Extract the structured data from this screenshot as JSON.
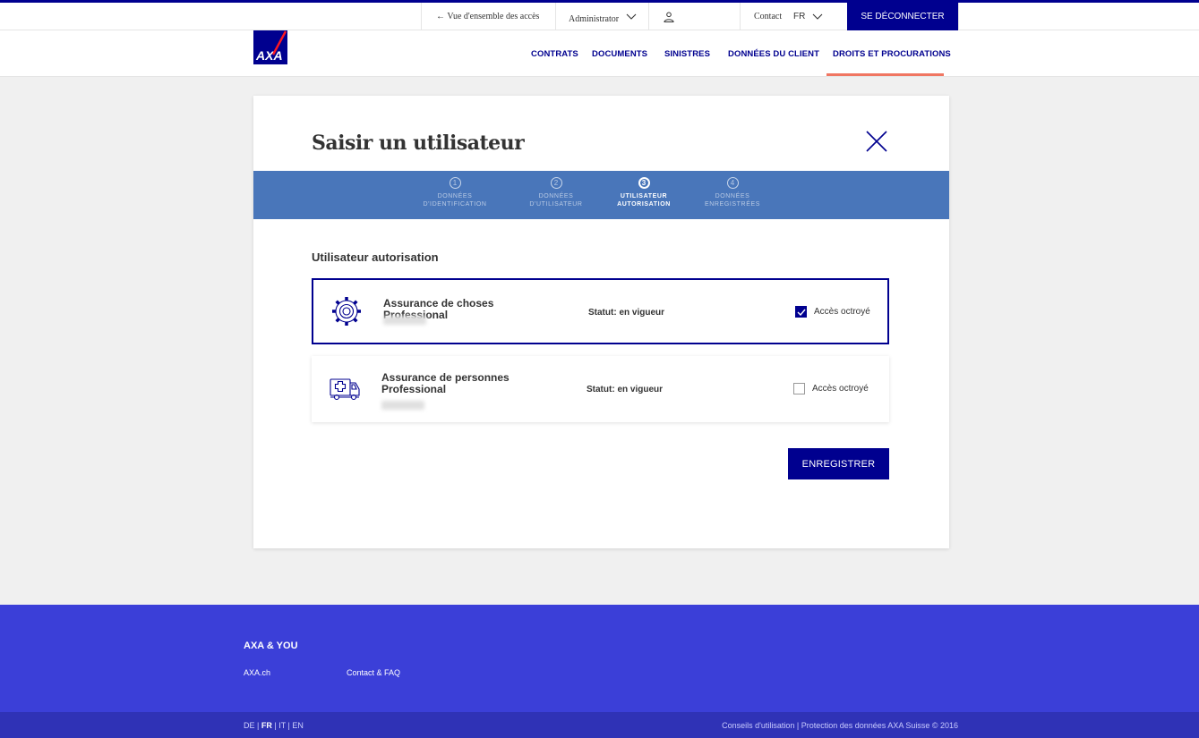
{
  "topbar": {
    "back_link": "← Vue d'ensemble des accès",
    "role_select": "Administrator",
    "contact": "Contact",
    "language": "FR",
    "logout": "SE DÉCONNECTER"
  },
  "header": {
    "logo_text": "AXA",
    "nav": [
      {
        "label": "CONTRATS",
        "active": false
      },
      {
        "label": "DOCUMENTS",
        "active": false
      },
      {
        "label": "SINISTRES",
        "active": false
      },
      {
        "label": "DONNÉES DU CLIENT",
        "active": false
      },
      {
        "label": "DROITS ET PROCURATIONS",
        "active": true
      }
    ]
  },
  "modal": {
    "title": "Saisir un utilisateur",
    "close_icon": "close-icon",
    "steps": [
      {
        "num": "1",
        "line1": "DONNÉES",
        "line2": "D'IDENTIFICATION",
        "active": false
      },
      {
        "num": "2",
        "line1": "DONNÉES",
        "line2": "D'UTILISATEUR",
        "active": false
      },
      {
        "num": "3",
        "line1": "UTILISATEUR",
        "line2": "AUTORISATION",
        "active": true
      },
      {
        "num": "4",
        "line1": "DONNÉES",
        "line2": "ENREGISTRÉES",
        "active": false
      }
    ],
    "section_title": "Utilisateur autorisation",
    "products": [
      {
        "name": "Assurance de choses Professional",
        "icon": "gear-icon",
        "status": "Statut: en vigueur",
        "access_label": "Accès octroyé",
        "checked": true
      },
      {
        "name": "Assurance de personnes Professional",
        "icon": "ambulance-icon",
        "status": "Statut: en vigueur",
        "access_label": "Accès octroyé",
        "checked": false
      }
    ],
    "save_label": "ENREGISTRER"
  },
  "footer": {
    "title": "AXA & YOU",
    "links": [
      "AXA.ch",
      "Contact & FAQ"
    ],
    "languages": [
      "DE",
      "FR",
      "IT",
      "EN"
    ],
    "current_language": "FR",
    "legal": "Conseils d'utilisation  |  Protection des données   AXA Suisse © 2016"
  },
  "colors": {
    "brand": "#00008f",
    "stepper": "#4976ba",
    "accent": "#f07662",
    "footer": "#3b3fd8"
  }
}
